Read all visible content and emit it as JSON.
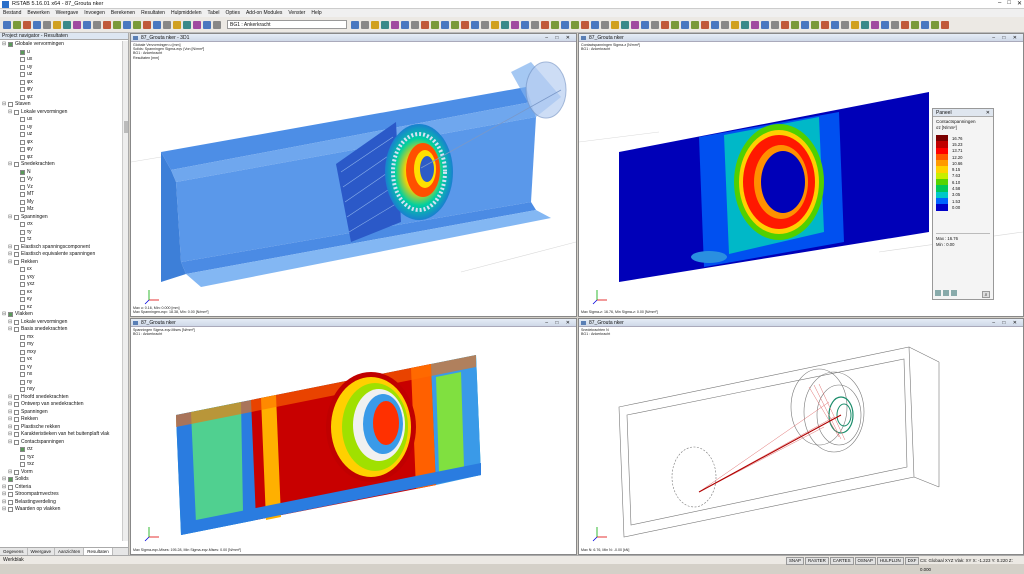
{
  "window": {
    "title": "RSTAB 5.16.01 x64 - 87_Grouta nker"
  },
  "menu": [
    "Bestand",
    "Bewerken",
    "Weergave",
    "Invoegen",
    "Berekenen",
    "Resultaten",
    "Hulpmiddelen",
    "Tabel",
    "Opties",
    "Add-on Modules",
    "Venster",
    "Help"
  ],
  "toolbar": {
    "loadcase": "BG1 : Ankerkracht"
  },
  "navigator": {
    "title": "Project navigator - Resultaten",
    "items": [
      {
        "label": "Globale vervormingen",
        "level": 0,
        "checked": true
      },
      {
        "label": "u",
        "level": 2,
        "checked": true
      },
      {
        "label": "ux",
        "level": 2,
        "checked": false
      },
      {
        "label": "uy",
        "level": 2,
        "checked": false
      },
      {
        "label": "uz",
        "level": 2,
        "checked": false
      },
      {
        "label": "φx",
        "level": 2,
        "checked": false
      },
      {
        "label": "φy",
        "level": 2,
        "checked": false
      },
      {
        "label": "φz",
        "level": 2,
        "checked": false
      },
      {
        "label": "Staven",
        "level": 0,
        "checked": false
      },
      {
        "label": "Lokale vervormingen",
        "level": 1,
        "checked": false
      },
      {
        "label": "ux",
        "level": 2,
        "checked": false
      },
      {
        "label": "uy",
        "level": 2,
        "checked": false
      },
      {
        "label": "uz",
        "level": 2,
        "checked": false
      },
      {
        "label": "φx",
        "level": 2,
        "checked": false
      },
      {
        "label": "φy",
        "level": 2,
        "checked": false
      },
      {
        "label": "φz",
        "level": 2,
        "checked": false
      },
      {
        "label": "Snedekrachten",
        "level": 1,
        "checked": false
      },
      {
        "label": "N",
        "level": 2,
        "checked": true
      },
      {
        "label": "Vy",
        "level": 2,
        "checked": false
      },
      {
        "label": "Vz",
        "level": 2,
        "checked": false
      },
      {
        "label": "MT",
        "level": 2,
        "checked": false
      },
      {
        "label": "My",
        "level": 2,
        "checked": false
      },
      {
        "label": "Mz",
        "level": 2,
        "checked": false
      },
      {
        "label": "Spanningen",
        "level": 1,
        "checked": false
      },
      {
        "label": "σx",
        "level": 2,
        "checked": false
      },
      {
        "label": "τy",
        "level": 2,
        "checked": false
      },
      {
        "label": "τz",
        "level": 2,
        "checked": false
      },
      {
        "label": "Elastisch spanningscomponent",
        "level": 1,
        "checked": false
      },
      {
        "label": "Elastisch equivalente spanningen",
        "level": 1,
        "checked": false
      },
      {
        "label": "Rekken",
        "level": 1,
        "checked": false
      },
      {
        "label": "εx",
        "level": 2,
        "checked": false
      },
      {
        "label": "γxy",
        "level": 2,
        "checked": false
      },
      {
        "label": "γxz",
        "level": 2,
        "checked": false
      },
      {
        "label": "κx",
        "level": 2,
        "checked": false
      },
      {
        "label": "κy",
        "level": 2,
        "checked": false
      },
      {
        "label": "κz",
        "level": 2,
        "checked": false
      },
      {
        "label": "Vlakken",
        "level": 0,
        "checked": true
      },
      {
        "label": "Lokale vervormingen",
        "level": 1,
        "checked": false
      },
      {
        "label": "Basis snedekrachten",
        "level": 1,
        "checked": false
      },
      {
        "label": "mx",
        "level": 2,
        "checked": false
      },
      {
        "label": "my",
        "level": 2,
        "checked": false
      },
      {
        "label": "mxy",
        "level": 2,
        "checked": false
      },
      {
        "label": "vx",
        "level": 2,
        "checked": false
      },
      {
        "label": "vy",
        "level": 2,
        "checked": false
      },
      {
        "label": "nx",
        "level": 2,
        "checked": false
      },
      {
        "label": "ny",
        "level": 2,
        "checked": false
      },
      {
        "label": "nxy",
        "level": 2,
        "checked": false
      },
      {
        "label": "Hoofd snedekrachten",
        "level": 1,
        "checked": false
      },
      {
        "label": "Ontwerp van snedekrachten",
        "level": 1,
        "checked": false
      },
      {
        "label": "Spanningen",
        "level": 1,
        "checked": false
      },
      {
        "label": "Rekken",
        "level": 1,
        "checked": false
      },
      {
        "label": "Plastische rekken",
        "level": 1,
        "checked": false
      },
      {
        "label": "Karakteristieken van het buitenplaft vlak",
        "level": 1,
        "checked": false
      },
      {
        "label": "Contactspanningen",
        "level": 1,
        "checked": false
      },
      {
        "label": "σz",
        "level": 2,
        "checked": true
      },
      {
        "label": "τyz",
        "level": 2,
        "checked": false
      },
      {
        "label": "τxz",
        "level": 2,
        "checked": false
      },
      {
        "label": "Vorm",
        "level": 1,
        "checked": false
      },
      {
        "label": "Solids",
        "level": 0,
        "checked": true
      },
      {
        "label": "Criteria",
        "level": 0,
        "checked": false
      },
      {
        "label": "Stroompatrnvectres",
        "level": 0,
        "checked": false
      },
      {
        "label": "Belastingverdeling",
        "level": 0,
        "checked": false
      },
      {
        "label": "Waarden op vlakken",
        "level": 0,
        "checked": false
      }
    ],
    "tabs": [
      "Gegevens",
      "Weergave",
      "Aanzichten",
      "Resultaten"
    ]
  },
  "views": {
    "tl": {
      "title": "87_Grouta nker - 3D1",
      "info": [
        "Globale Vervormingen u [mm]",
        "Solids: Spanningen Sigma-eqv (Von [N/mm²]",
        "BG1 : Ankerkracht",
        "Resultaten [mm]"
      ],
      "footer": [
        "Max u: 0.16, Min: 0.000 [mm]",
        "Max Spanningen-eqv: 18.38, Min: 0.00 [N/mm²]"
      ]
    },
    "tr": {
      "title": "87_Grouta nker",
      "info": [
        "Contactspanningen Sigma-z [N/mm²]",
        "BG1 : Ankerkracht"
      ],
      "footer": [
        "Max Sigma-z: 16.76, Min Sigma-z: 0.00 [N/mm²]"
      ]
    },
    "bl": {
      "title": "87_Grouta nker",
      "info": [
        "Spanningen Sigma-eqv-Mises [N/mm²]",
        "BG1 : Ankerkracht"
      ],
      "footer": [
        "Max Sigma-eqv-Mises: 195.28, Min Sigma-eqv-Mises: 0.00 [N/mm²]"
      ]
    },
    "br": {
      "title": "87_Grouta nker",
      "info": [
        "Snedekrachten N",
        "BG1 : Ankerkracht"
      ],
      "footer": [
        "Max N: 6.76, Min N: -0.00 [kN]"
      ]
    }
  },
  "panel": {
    "title": "Paneel",
    "caption": "Contactspanningen",
    "unit": "σz [N/mm²]",
    "legend": [
      {
        "value": "16.76",
        "color": "#7a0000"
      },
      {
        "value": "15.23",
        "color": "#c00000"
      },
      {
        "value": "13.71",
        "color": "#ff0000"
      },
      {
        "value": "12.20",
        "color": "#ff5a00"
      },
      {
        "value": "10.66",
        "color": "#ff9a00"
      },
      {
        "value": "9.15",
        "color": "#ffd200"
      },
      {
        "value": "7.63",
        "color": "#c8ee00"
      },
      {
        "value": "6.10",
        "color": "#55d400"
      },
      {
        "value": "4.58",
        "color": "#00c85a"
      },
      {
        "value": "3.05",
        "color": "#00c8c8"
      },
      {
        "value": "1.53",
        "color": "#0064ff"
      },
      {
        "value": "0.00",
        "color": "#0000c8"
      }
    ],
    "max_label": "Max :",
    "max_value": "16.76",
    "min_label": "Min :",
    "min_value": "0.00"
  },
  "status": {
    "left": "Werkblak",
    "modes": [
      "SNAP",
      "RASTER",
      "CARTES",
      "OSNAP",
      "HULPLIJN",
      "DXF"
    ],
    "coords": "CS: Globaal XYZ  Vlak: XY    X: -1.223 Y: 0.220 Z: 0.000"
  }
}
